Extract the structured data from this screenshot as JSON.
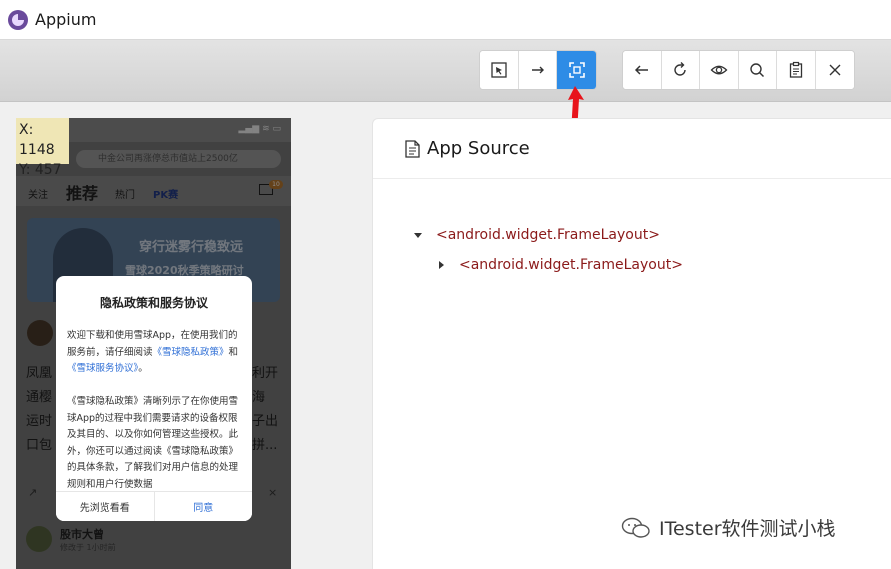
{
  "app": {
    "title": "Appium"
  },
  "toolbar": {
    "group1": [
      "select-element-icon",
      "swipe-icon",
      "tap-coordinates-icon"
    ],
    "group2": [
      "back-icon",
      "refresh-icon",
      "eye-icon",
      "search-icon",
      "clipboard-icon",
      "close-icon"
    ],
    "active_color": "#2e8ce6"
  },
  "device": {
    "coords": {
      "x_label": "X: 1148",
      "y_label": "Y: 457"
    },
    "search_text": "中金公司再涨停总市值站上2500亿",
    "nav": {
      "follow": "关注",
      "recommend": "推荐",
      "hot": "热门",
      "pk": "PK赛"
    },
    "mail_badge": "10",
    "banner": {
      "line1": "穿行迷雾行稳致远",
      "line2": "雪球2020秋季策略研讨"
    },
    "feed_lines": [
      "凤凰",
      "通樱",
      "运时",
      "口包"
    ],
    "feed_right": [
      "利开",
      "海",
      "子出",
      "拼..."
    ],
    "author": {
      "name": "股市大曾",
      "sub": "修改于 1小时前"
    }
  },
  "dialog": {
    "title": "隐私政策和服务协议",
    "p1_before": "欢迎下载和使用雪球App，在使用我们的服务前，请仔细阅读",
    "p1_link1": "《雪球隐私政策》",
    "p1_and": "和",
    "p1_link2": "《雪球服务协议》",
    "p1_end": "。",
    "p2": "《雪球隐私政策》清晰列示了在你使用雪球App的过程中我们需要请求的设备权限及其目的、以及你如何管理这些授权。此外，你还可以通过阅读《雪球隐私政策》的具体条款，了解我们对用户信息的处理规则和用户行使数据",
    "cancel": "先浏览看看",
    "ok": "同意"
  },
  "source": {
    "title": "App Source",
    "nodes": [
      {
        "label": "<android.widget.FrameLayout>",
        "expanded": true
      },
      {
        "label": "<android.widget.FrameLayout>",
        "expanded": false
      }
    ]
  },
  "watermark": {
    "text": "ITester软件测试小栈"
  }
}
